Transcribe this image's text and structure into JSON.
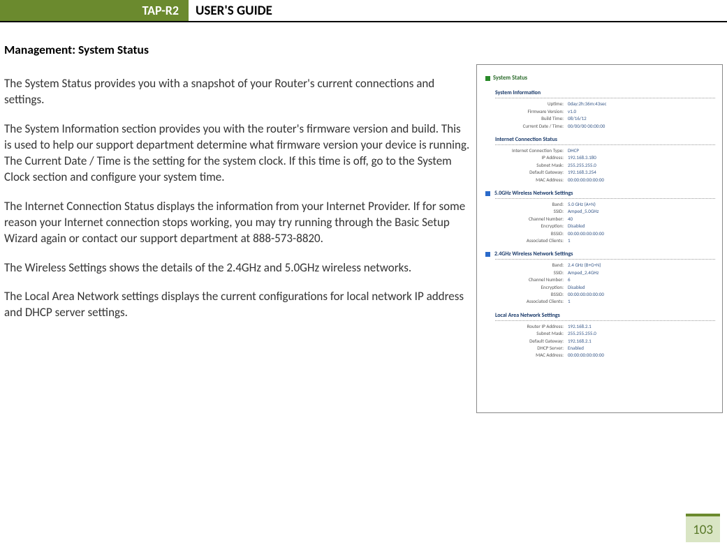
{
  "header": {
    "model": "TAP-R2",
    "title": "USER'S GUIDE"
  },
  "page": {
    "section_title": "Management: System Status",
    "paragraphs": [
      "The System Status provides you with a snapshot of your Router's current connections and settings.",
      "The System Information section provides you with the router's firmware version and build.  This is used to help our support department determine what firmware version your device is running.  The Current Date / Time is the setting for the system clock.  If this time is off, go to the System Clock section and configure your system time.",
      "The Internet Connection Status displays the information from your Internet Provider.  If for some reason your Internet connection stops working, you may try running through the Basic Setup Wizard again or contact our support department at 888-573-8820.",
      "The Wireless Settings shows the details of the 2.4GHz and 5.0GHz wireless networks.",
      "The Local Area Network settings displays the current configurations for local network IP address and DHCP server settings."
    ],
    "number": "103"
  },
  "screenshot": {
    "main_title": "System Status",
    "sections": [
      {
        "title": "System Information",
        "blue_sq": false,
        "rows": [
          {
            "label": "Uptime:",
            "value": "0day:2h:36m:43sec"
          },
          {
            "label": "Firmware Version:",
            "value": "v1.0"
          },
          {
            "label": "Build Time:",
            "value": "08/16/12"
          },
          {
            "label": "Current Date / Time:",
            "value": "00/00/00 00:00:00"
          }
        ]
      },
      {
        "title": "Internet Connection Status",
        "blue_sq": false,
        "rows": [
          {
            "label": "Internet Connection Type:",
            "value": "DHCP"
          },
          {
            "label": "IP Address:",
            "value": "192.168.3.180"
          },
          {
            "label": "Subnet Mask:",
            "value": "255.255.255.0"
          },
          {
            "label": "Default Gateway:",
            "value": "192.168.3.254"
          },
          {
            "label": "MAC Address:",
            "value": "00:00:00:00:00:00"
          }
        ]
      },
      {
        "title": "5.0GHz Wireless Network Settings",
        "blue_sq": true,
        "rows": [
          {
            "label": "Band:",
            "value": "5.0 GHz (A+N)"
          },
          {
            "label": "SSID:",
            "value": "Amped_5.0GHz"
          },
          {
            "label": "Channel Number:",
            "value": "40"
          },
          {
            "label": "Encryption:",
            "value": "Disabled"
          },
          {
            "label": "BSSID:",
            "value": "00:00:00:00:00:00"
          },
          {
            "label": "Associated Clients:",
            "value": "1"
          }
        ]
      },
      {
        "title": "2.4GHz Wireless Network Settings",
        "blue_sq": true,
        "rows": [
          {
            "label": "Band:",
            "value": "2.4 GHz (B+G+N)"
          },
          {
            "label": "SSID:",
            "value": "Amped_2.4GHz"
          },
          {
            "label": "Channel Number:",
            "value": "6"
          },
          {
            "label": "Encryption:",
            "value": "Disabled"
          },
          {
            "label": "BSSID:",
            "value": "00:00:00:00:00:00"
          },
          {
            "label": "Associated Clients:",
            "value": "1"
          }
        ]
      },
      {
        "title": "Local Area Network Settings",
        "blue_sq": false,
        "rows": [
          {
            "label": "Router IP Address:",
            "value": "192.168.2.1"
          },
          {
            "label": "Subnet Mask:",
            "value": "255.255.255.0"
          },
          {
            "label": "Default Gateway:",
            "value": "192.168.2.1"
          },
          {
            "label": "DHCP Server:",
            "value": "Enabled"
          },
          {
            "label": "MAC Address:",
            "value": "00:00:00:00:00:00"
          }
        ]
      }
    ]
  }
}
